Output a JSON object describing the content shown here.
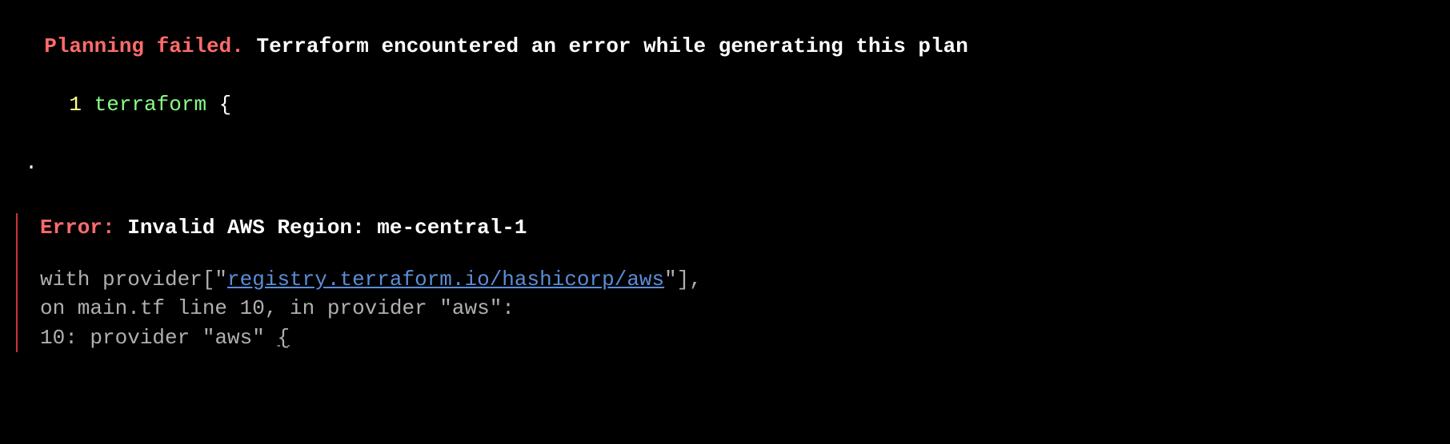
{
  "header": {
    "planning_failed": "Planning failed.",
    "subtitle": " Terraform encountered an error while generating this plan"
  },
  "code_preview": {
    "line_number": "  1 ",
    "keyword": "terraform",
    "brace": " {"
  },
  "dot": ".",
  "error": {
    "label": "Error:",
    "message": " Invalid AWS Region: me-central-1",
    "with_prefix": "  with provider[\"",
    "provider_link": "registry.terraform.io/hashicorp/aws",
    "with_suffix": "\"],",
    "location_line": "  on main.tf line 10, in provider \"aws\":",
    "code_line_num": "  10: ",
    "code_line_content": "provider \"aws\" ",
    "code_line_brace": "{"
  }
}
